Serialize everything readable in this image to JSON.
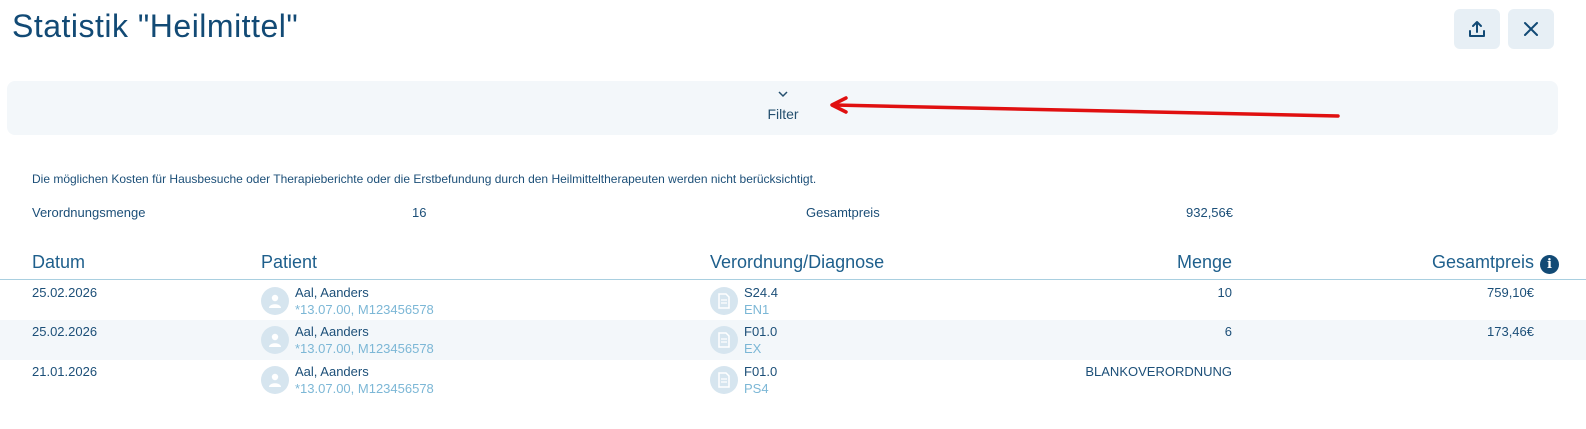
{
  "page": {
    "title": "Statistik \"Heilmittel\""
  },
  "toolbar": {
    "export_icon": "upload-icon",
    "close_icon": "close-icon"
  },
  "filter": {
    "label": "Filter",
    "chevron": "chevron-down-icon"
  },
  "summary": {
    "note": "Die möglichen Kosten für Hausbesuche oder Therapieberichte oder die Erstbefundung durch den Heilmitteltherapeuten werden nicht berücksichtigt.",
    "quantity_label": "Verordnungsmenge",
    "quantity_value": "16",
    "total_label": "Gesamtpreis",
    "total_value": "932,56€"
  },
  "table": {
    "columns": {
      "datum": "Datum",
      "patient": "Patient",
      "verordnung": "Verordnung/Diagnose",
      "menge": "Menge",
      "gesamtpreis": "Gesamtpreis"
    },
    "rows": [
      {
        "datum": "25.02.2026",
        "patient_name": "Aal, Aanders",
        "patient_info": "*13.07.00, M123456578",
        "code": "S24.4",
        "sub": "EN1",
        "menge": "10",
        "preis": "759,10€"
      },
      {
        "datum": "25.02.2026",
        "patient_name": "Aal, Aanders",
        "patient_info": "*13.07.00, M123456578",
        "code": "F01.0",
        "sub": "EX",
        "menge": "6",
        "preis": "173,46€"
      },
      {
        "datum": "21.01.2026",
        "patient_name": "Aal, Aanders",
        "patient_info": "*13.07.00, M123456578",
        "code": "F01.0",
        "sub": "PS4",
        "menge": "BLANKOVERORDNUNG",
        "preis": ""
      }
    ]
  },
  "colors": {
    "accent": "#124a75",
    "annotation_arrow": "#e01010"
  }
}
